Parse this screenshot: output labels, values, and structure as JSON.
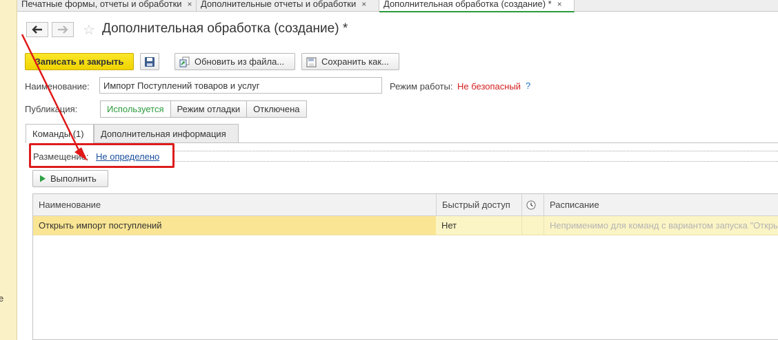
{
  "tabs": [
    {
      "label": "Печатные формы, отчеты и обработки",
      "close": "×"
    },
    {
      "label": "Дополнительные отчеты и обработки",
      "close": "×"
    },
    {
      "label": "Дополнительная обработка (создание) *",
      "close": "×"
    }
  ],
  "left_panel": {
    "cut_text": "е"
  },
  "header": {
    "back_icon": "arrow-left-icon",
    "forward_icon": "arrow-right-icon",
    "favorite_icon": "star-icon",
    "title": "Дополнительная обработка (создание) *"
  },
  "toolbar": {
    "save_close_label": "Записать и закрыть",
    "save_icon": "floppy-disk-icon",
    "update_label": "Обновить из файла...",
    "save_as_label": "Сохранить как..."
  },
  "form": {
    "name_label": "Наименование:",
    "name_value": "Импорт Поступлений товаров и услуг",
    "mode_label": "Режим работы:",
    "mode_value": "Не безопасный",
    "help": "?",
    "publication_label": "Публикация:",
    "publication_options": [
      "Используется",
      "Режим отладки",
      "Отключена"
    ],
    "publication_selected": "Используется"
  },
  "content_tabs": [
    {
      "label": "Команды (1)"
    },
    {
      "label": "Дополнительная информация"
    }
  ],
  "commands": {
    "placement_label": "Размещение:",
    "placement_value": "Не определено",
    "run_label": "Выполнить",
    "table": {
      "headers": [
        "Наименование",
        "Быстрый доступ",
        "",
        "Расписание"
      ],
      "rows": [
        [
          "Открыть импорт поступлений",
          "Нет",
          "",
          "Неприменимо для команд с вариантом запуска \"Открытие формы\""
        ]
      ]
    }
  },
  "colors": {
    "primary_button": "#f6dd10",
    "active_green": "#2b9a3b",
    "warning_red": "#d42020",
    "link_blue": "#1a4f9c",
    "highlight_box": "#dd1c1c",
    "selected_row": "#fae594"
  }
}
